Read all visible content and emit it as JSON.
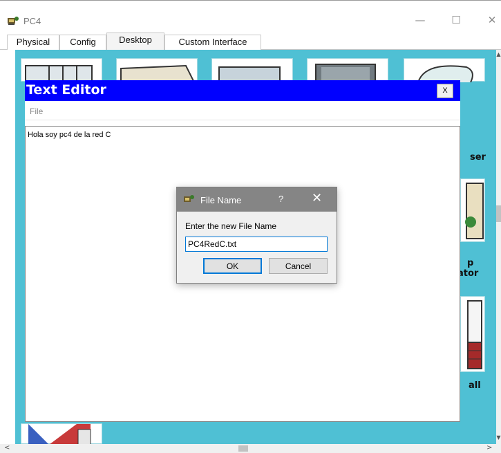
{
  "window": {
    "title": "PC4",
    "controls": {
      "minimize": "—",
      "maximize": "☐",
      "close": "✕"
    }
  },
  "tabs": [
    {
      "label": "Physical"
    },
    {
      "label": "Config"
    },
    {
      "label": "Desktop",
      "active": true
    },
    {
      "label": "Custom Interface"
    }
  ],
  "desktop": {
    "background_color": "#4fc0d4",
    "partial_labels": [
      "ser",
      "p",
      "ator",
      "all"
    ]
  },
  "editor": {
    "title": "Text Editor",
    "close_label": "X",
    "menu": [
      "File"
    ],
    "content": "Hola soy pc4 de la red C",
    "title_bar_color": "#0000ff"
  },
  "dialog": {
    "title": "File Name",
    "help_label": "?",
    "close_label": "✕",
    "prompt": "Enter the new File Name",
    "input_value": "PC4RedC.txt",
    "ok_label": "OK",
    "cancel_label": "Cancel"
  },
  "scrollbars": {
    "up": "▲",
    "down": "▼",
    "left": "<",
    "right": ">"
  }
}
